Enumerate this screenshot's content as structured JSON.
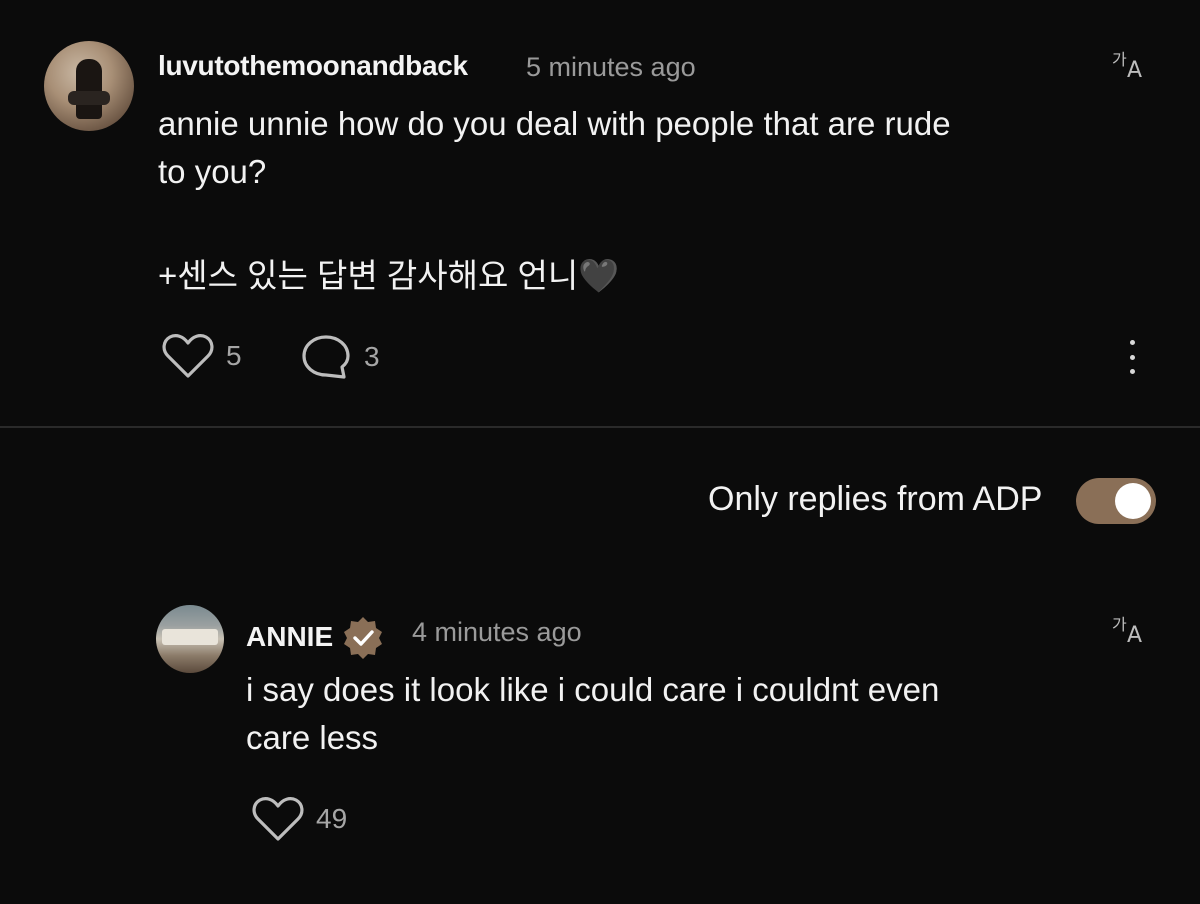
{
  "post": {
    "username": "luvutothemoonandback",
    "timestamp": "5 minutes ago",
    "text": "annie unnie how do you deal with people that are rude\nto you?",
    "text_korean": "+센스 있는 답변 감사해요 언니🖤",
    "likes": "5",
    "comments": "3",
    "translate_icon": "translate-icon",
    "more_icon": "more-vertical-icon"
  },
  "filter": {
    "label": "Only replies from ADP",
    "enabled": true,
    "accent": "#8a6f57"
  },
  "reply": {
    "username": "ANNIE",
    "verified_icon": "verified-badge-icon",
    "timestamp": "4 minutes ago",
    "text": "i say does it look like i could care i couldnt even\ncare less",
    "likes": "49"
  },
  "translate_glyphs": {
    "ko": "가",
    "en": "A"
  }
}
